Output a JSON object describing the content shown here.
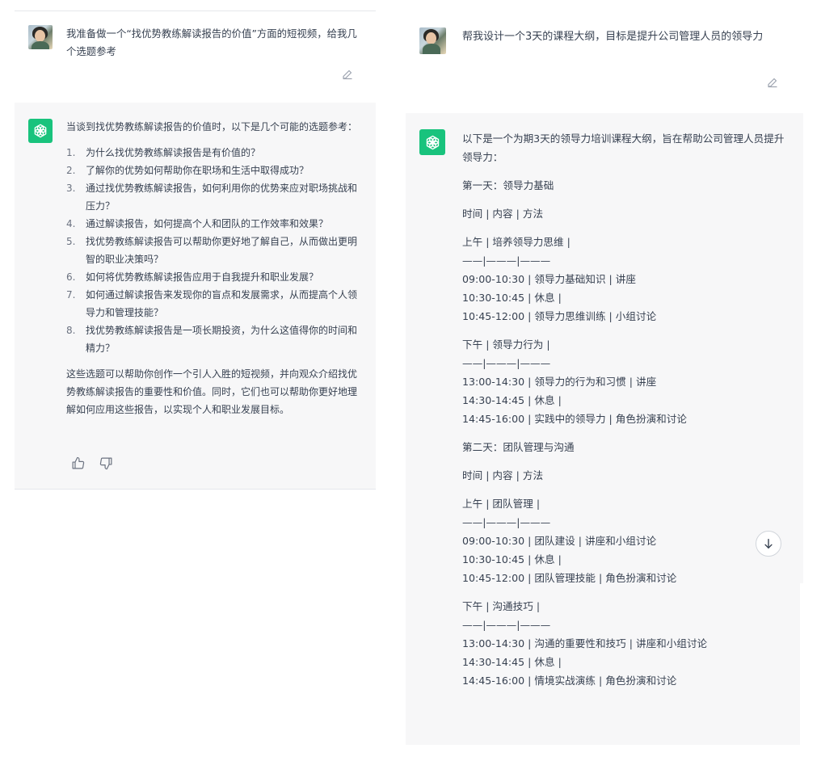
{
  "left": {
    "user_message": "我准备做一个“找优势教练解读报告的价值”方面的短视频，给我几个选题参考",
    "assistant_intro": "当谈到找优势教练解读报告的价值时，以下是几个可能的选题参考：",
    "list": [
      {
        "num": "1.",
        "text": "为什么找优势教练解读报告是有价值的？"
      },
      {
        "num": "2.",
        "text": "了解你的优势如何帮助你在职场和生活中取得成功？"
      },
      {
        "num": "3.",
        "text": "通过找优势教练解读报告，如何利用你的优势来应对职场挑战和压力？"
      },
      {
        "num": "4.",
        "text": "通过解读报告，如何提高个人和团队的工作效率和效果？"
      },
      {
        "num": "5.",
        "text": "找优势教练解读报告可以帮助你更好地了解自己，从而做出更明智的职业决策吗？"
      },
      {
        "num": "6.",
        "text": "如何将优势教练解读报告应用于自我提升和职业发展？"
      },
      {
        "num": "7.",
        "text": "如何通过解读报告来发现你的盲点和发展需求，从而提高个人领导力和管理技能？"
      },
      {
        "num": "8.",
        "text": "找优势教练解读报告是一项长期投资，为什么这值得你的时间和精力？"
      }
    ],
    "assistant_outro": "这些选题可以帮助你创作一个引人入胜的短视频，并向观众介绍找优势教练解读报告的重要性和价值。同时，它们也可以帮助你更好地理解如何应用这些报告，以实现个人和职业发展目标。"
  },
  "right": {
    "user_message": "帮我设计一个3天的课程大纲，目标是提升公司管理人员的领导力",
    "assistant_intro": "以下是一个为期3天的领导力培训课程大纲，旨在帮助公司管理人员提升领导力：",
    "day1_title": "第一天：领导力基础",
    "header_row": "时间 | 内容 | 方法",
    "d1_am_title": "上午 | 培养领导力思维 |",
    "sep": "——|———|———",
    "d1_am_rows": [
      "09:00-10:30 | 领导力基础知识 | 讲座",
      "10:30-10:45 | 休息 |",
      "10:45-12:00 | 领导力思维训练 | 小组讨论"
    ],
    "d1_pm_title": "下午 | 领导力行为 |",
    "d1_pm_rows": [
      "13:00-14:30 | 领导力的行为和习惯 | 讲座",
      "14:30-14:45 | 休息 |",
      "14:45-16:00 | 实践中的领导力 | 角色扮演和讨论"
    ],
    "day2_title": "第二天：团队管理与沟通",
    "header_row2": "时间 | 内容 | 方法",
    "d2_am_title": "上午 | 团队管理 |",
    "d2_am_rows": [
      "09:00-10:30 | 团队建设 | 讲座和小组讨论",
      "10:30-10:45 | 休息 |",
      "10:45-12:00 | 团队管理技能 | 角色扮演和讨论"
    ],
    "d2_pm_title": "下午 | 沟通技巧 |",
    "d2_pm_rows": [
      "13:00-14:30 | 沟通的重要性和技巧 | 讲座和小组讨论",
      "14:30-14:45 | 休息 |",
      "14:45-16:00 | 情境实战演练 | 角色扮演和讨论"
    ]
  },
  "colors": {
    "assistant_bg": "#f7f7f8",
    "gpt_green": "#19c37d",
    "text": "#374151"
  },
  "icons": [
    "user-avatar",
    "chatgpt-logo-icon",
    "edit-icon",
    "thumbs-up-icon",
    "thumbs-down-icon",
    "arrow-down-icon"
  ]
}
